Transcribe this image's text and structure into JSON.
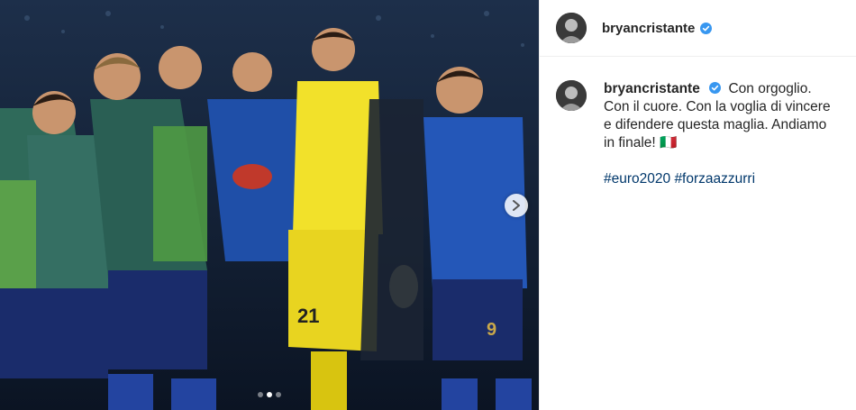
{
  "post": {
    "username": "bryancristante",
    "verified": true,
    "caption": {
      "username": "bryancristante",
      "text": "Con orgoglio. Con il cuore. Con la voglia di vincere e difendere questa maglia. Andiamo in finale! 🇮🇹",
      "hashtags": [
        "#euro2020",
        "#forzaazzurri"
      ]
    },
    "carousel": {
      "total_slides": 3,
      "active_slide": 2
    }
  },
  "icons": {
    "verified": "verified-badge-icon",
    "next": "chevron-right-icon"
  },
  "colors": {
    "verified_blue": "#3897f0",
    "hashtag_blue": "#00376b",
    "goalkeeper_yellow": "#f2e12a",
    "italy_blue": "#1f4fa8",
    "staff_green": "#2f6a5a"
  }
}
